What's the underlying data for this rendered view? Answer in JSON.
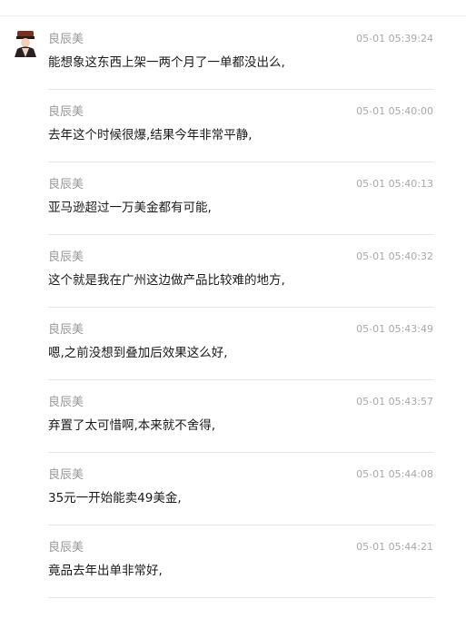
{
  "chat": {
    "messages": [
      {
        "sender": "良辰美",
        "time": "05-01 05:39:24",
        "text": "能想象这东西上架一两个月了一单都没出么,",
        "avatar": "user-avatar"
      },
      {
        "sender": "良辰美",
        "time": "05-01 05:40:00",
        "text": "去年这个时候很爆,结果今年非常平静,"
      },
      {
        "sender": "良辰美",
        "time": "05-01 05:40:13",
        "text": "亚马逊超过一万美金都有可能,"
      },
      {
        "sender": "良辰美",
        "time": "05-01 05:40:32",
        "text": "这个就是我在广州这边做产品比较难的地方,"
      },
      {
        "sender": "良辰美",
        "time": "05-01 05:43:49",
        "text": "嗯,之前没想到叠加后效果这么好,"
      },
      {
        "sender": "良辰美",
        "time": "05-01 05:43:57",
        "text": "弃置了太可惜啊,本来就不舍得,"
      },
      {
        "sender": "良辰美",
        "time": "05-01 05:44:08",
        "text": "35元一开始能卖49美金,"
      },
      {
        "sender": "良辰美",
        "time": "05-01 05:44:21",
        "text": "竟品去年出单非常好,"
      }
    ]
  },
  "colors": {
    "sender": "#9a9a9a",
    "time": "#a8a8a8",
    "text": "#1a1a1a",
    "divider": "#e6e6e6"
  }
}
